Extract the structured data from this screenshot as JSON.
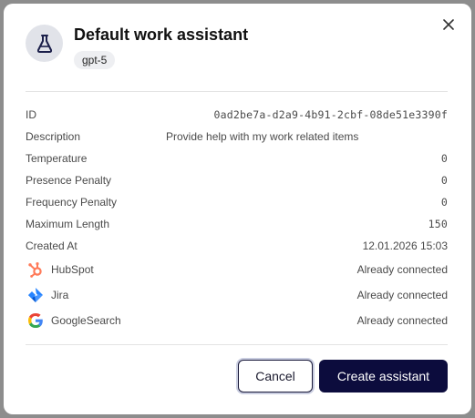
{
  "dialog": {
    "title": "Default work assistant",
    "model": "gpt-5"
  },
  "details": [
    {
      "label": "ID",
      "value": "0ad2be7a-d2a9-4b91-2cbf-08de51e3390f"
    },
    {
      "label": "Description",
      "value": "Provide help with my work related items"
    },
    {
      "label": "Temperature",
      "value": "0"
    },
    {
      "label": "Presence Penalty",
      "value": "0"
    },
    {
      "label": "Frequency Penalty",
      "value": "0"
    },
    {
      "label": "Maximum Length",
      "value": "150"
    },
    {
      "label": "Created At",
      "value": "12.01.2026 15:03"
    }
  ],
  "integrations": [
    {
      "name": "HubSpot",
      "status": "Already connected",
      "icon": "hubspot-icon",
      "color": "#ff7a59"
    },
    {
      "name": "Jira",
      "status": "Already connected",
      "icon": "jira-icon",
      "color": "#2684ff"
    },
    {
      "name": "GoogleSearch",
      "status": "Already connected",
      "icon": "google-icon",
      "color": "#4285f4"
    }
  ],
  "footer": {
    "cancel_label": "Cancel",
    "create_label": "Create assistant"
  },
  "colors": {
    "primary": "#0c0c3d",
    "avatar_bg": "#e1e3e9",
    "backdrop": "#8d8d8d"
  }
}
